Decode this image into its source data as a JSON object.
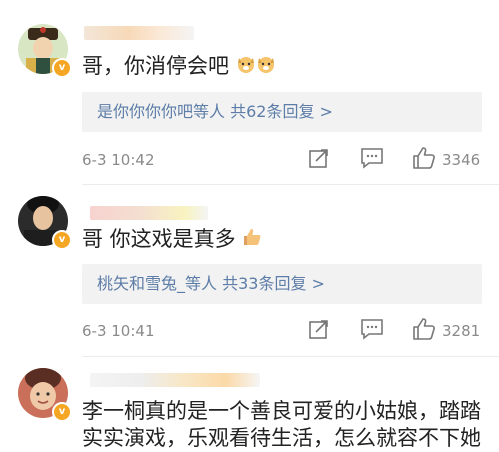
{
  "comments": [
    {
      "text": "哥，你消停会吧",
      "reply_summary": "是你你你你吧等人 共62条回复 >",
      "date": "6-3 10:42",
      "likes": "3346",
      "verified_badge": "v"
    },
    {
      "text": "哥 你这戏是真多",
      "reply_summary": "桃矢和雪兔_等人 共33条回复 >",
      "date": "6-3 10:41",
      "likes": "3281",
      "verified_badge": "v"
    },
    {
      "text_line1": "李一桐真的是一个善良可爱的小姑娘，踏踏",
      "text_line2": "实实演戏，乐观看待生活，怎么就容不下她",
      "verified_badge": "v"
    }
  ],
  "icons": {
    "share": "share-icon",
    "comment": "comment-icon",
    "like": "thumbs-up-icon"
  },
  "colors": {
    "link_blue": "#5d7da8",
    "meta_gray": "#8a8a8a",
    "badge_orange": "#f5a623",
    "reply_bg": "#f2f2f2"
  }
}
